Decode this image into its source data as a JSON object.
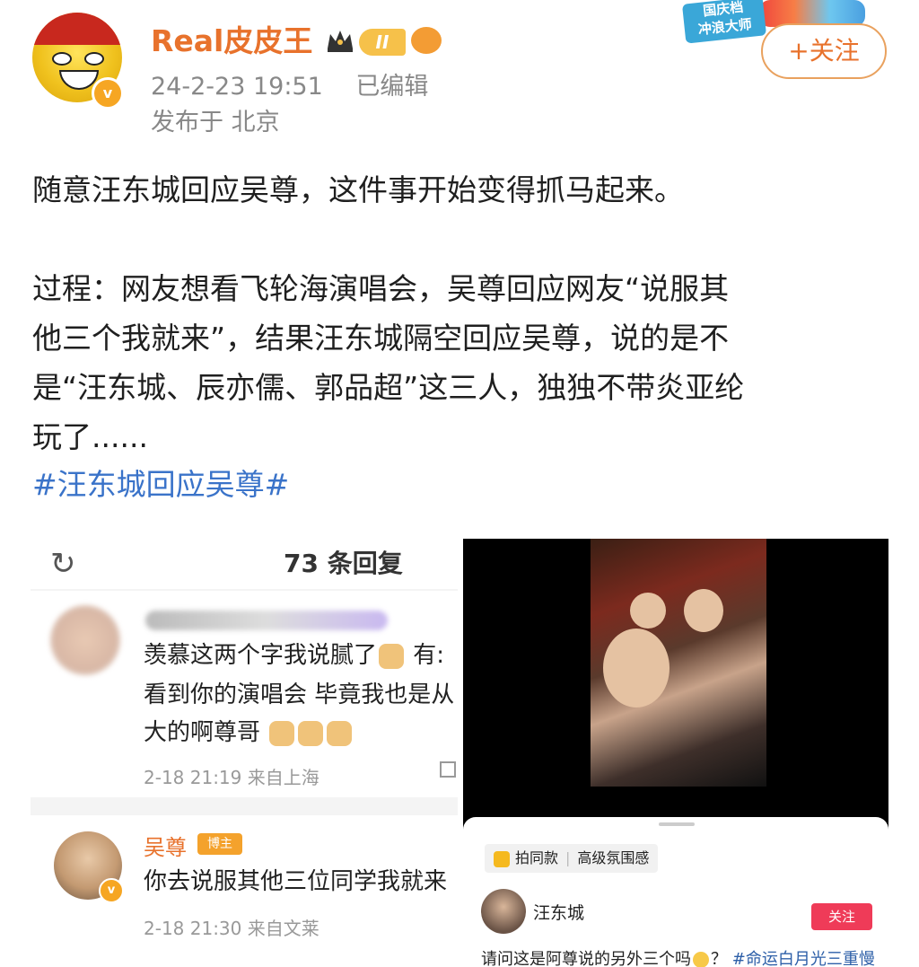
{
  "header": {
    "username": "Real皮皮王",
    "level_badge": "II",
    "verified_badge": "v",
    "timestamp": "24-2-23 19:51",
    "edited": "已编辑",
    "location": "发布于 北京",
    "promo_badge": "国庆档\n冲浪大师",
    "follow_label": "+关注"
  },
  "post": {
    "line1": "随意汪东城回应吴尊，这件事开始变得抓马起来。",
    "line2": "过程：网友想看飞轮海演唱会，吴尊回应网友“说服其",
    "line3": "他三个我就来”，结果汪东城隔空回应吴尊，说的是不",
    "line4": "是“汪东城、辰亦儒、郭品超”这三人，独独不带炎亚纶",
    "line5": "玩了......",
    "hashtag": "#汪东城回应吴尊#"
  },
  "left_screenshot": {
    "reply_count": "73 条回复",
    "comment1": {
      "text_line1": "羡慕这两个字我说腻了",
      "text_line1_tail": "有:",
      "text_line2": "看到你的演唱会 毕竟我也是从",
      "text_line3": "大的啊尊哥",
      "meta": "2-18 21:19  来自上海"
    },
    "comment2": {
      "author": "吴尊",
      "badge": "博主",
      "text": "你去说服其他三位同学我就来",
      "meta": "2-18 21:30  来自文莱"
    }
  },
  "right_screenshot": {
    "tag1": "拍同款",
    "tag2": "高级氛围感",
    "author": "汪东城",
    "follow_label": "关注",
    "caption": "请问这是阿尊说的另外三个吗",
    "caption_mid": "？",
    "caption_tag": "#命运白月光三重慢"
  }
}
